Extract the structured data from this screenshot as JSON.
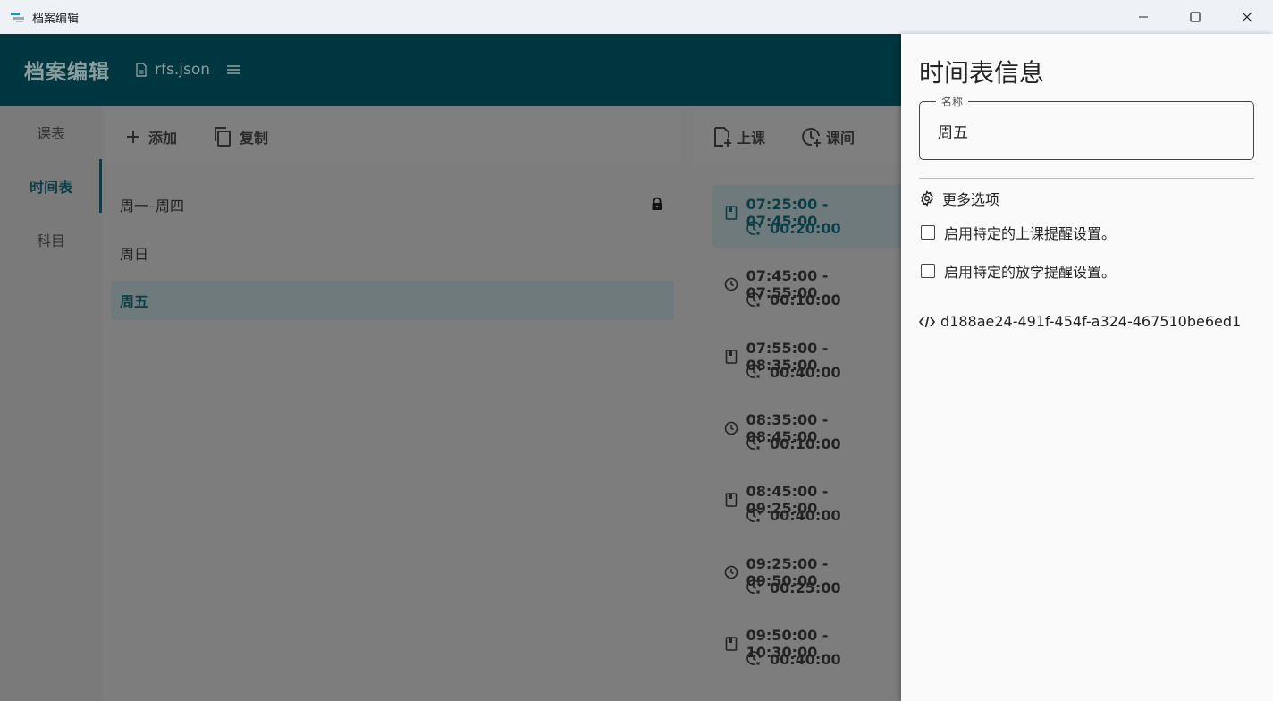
{
  "window": {
    "title": "档案编辑"
  },
  "appbar": {
    "title": "档案编辑",
    "file_name": "rfs.json"
  },
  "nav": {
    "items": [
      "课表",
      "时间表",
      "科目"
    ],
    "active_index": 1
  },
  "middle": {
    "toolbar": {
      "add_label": "添加",
      "copy_label": "复制"
    },
    "items": [
      {
        "label": "周一–周四",
        "locked": true
      },
      {
        "label": "周日",
        "locked": false
      },
      {
        "label": "周五",
        "locked": false,
        "selected": true
      }
    ]
  },
  "timeline": {
    "toolbar": {
      "class_label": "上课",
      "break_label": "课间"
    },
    "items": [
      {
        "kind": "class",
        "range": "07:25:00 - 07:45:00",
        "duration": "00:20:00",
        "selected": true
      },
      {
        "kind": "break",
        "range": "07:45:00 - 07:55:00",
        "duration": "00:10:00"
      },
      {
        "kind": "class",
        "range": "07:55:00 - 08:35:00",
        "duration": "00:40:00"
      },
      {
        "kind": "break",
        "range": "08:35:00 - 08:45:00",
        "duration": "00:10:00"
      },
      {
        "kind": "class",
        "range": "08:45:00 - 09:25:00",
        "duration": "00:40:00"
      },
      {
        "kind": "break",
        "range": "09:25:00 - 09:50:00",
        "duration": "00:25:00"
      },
      {
        "kind": "class",
        "range": "09:50:00 - 10:30:00",
        "duration": "00:40:00"
      }
    ]
  },
  "drawer": {
    "title": "时间表信息",
    "name_label": "名称",
    "name_value": "周五",
    "more_options": "更多选项",
    "checkbox_class_reminder": "启用特定的上课提醒设置。",
    "checkbox_after_school": "启用特定的放学提醒设置。",
    "guid": "d188ae24-491f-454f-a324-467510be6ed1"
  },
  "colors": {
    "accent": "#00363f",
    "drawer_bg": "#fafafa",
    "scrim": "#7d7d7d"
  }
}
